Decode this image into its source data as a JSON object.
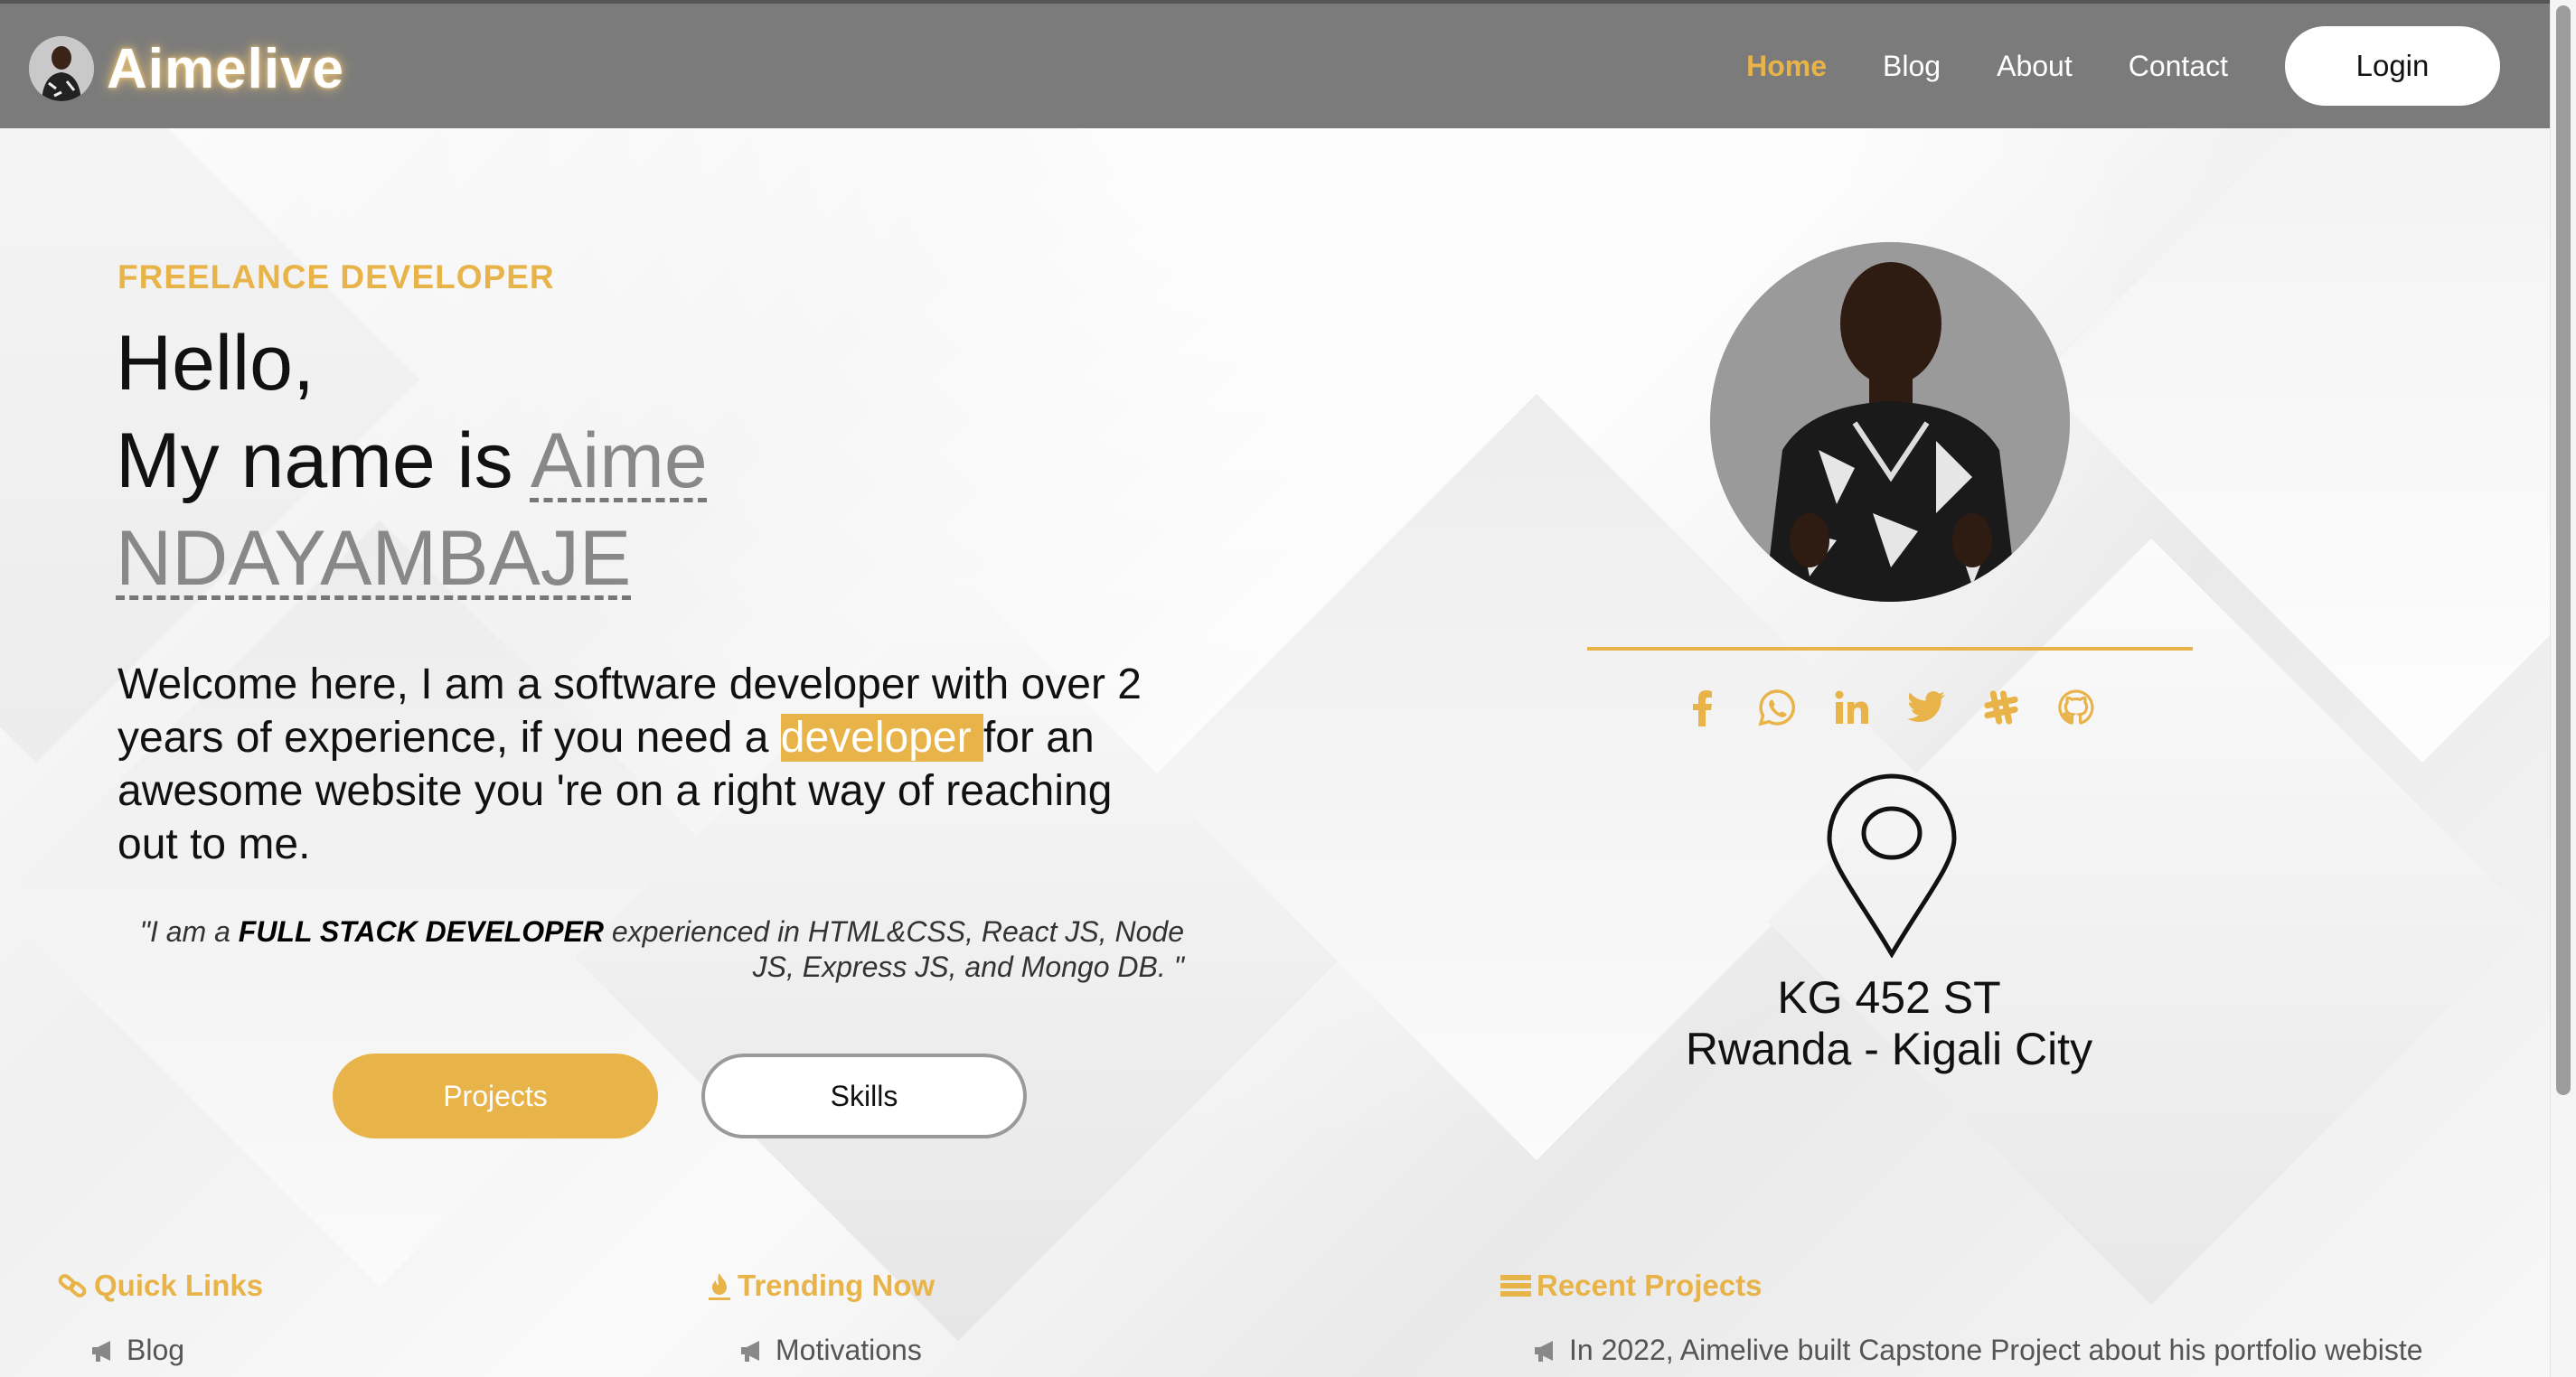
{
  "brand": {
    "name": "Aimelive"
  },
  "nav": {
    "items": [
      "Home",
      "Blog",
      "About",
      "Contact"
    ],
    "active": "Home",
    "login": "Login"
  },
  "hero": {
    "eyebrow": "FREELANCE DEVELOPER",
    "greeting_line1": "Hello,",
    "greeting_line2": "My name is ",
    "name_first": "Aime",
    "name_last": "NDAYAMBAJE",
    "intro_before": "Welcome here, I am a software developer with over 2 years of experience, if you need a ",
    "intro_highlight": "developer ",
    "intro_after": "for an awesome website you 're on a right way of reaching out to me.",
    "quote_before": "\"I am a ",
    "quote_bold": "FULL STACK DEVELOPER",
    "quote_after": " experienced in HTML&CSS, React JS, Node JS, Express JS, and Mongo DB. \"",
    "projects_button": "Projects",
    "skills_button": "Skills"
  },
  "profile": {
    "socials": [
      "facebook-icon",
      "whatsapp-icon",
      "linkedin-icon",
      "twitter-icon",
      "slack-icon",
      "github-icon"
    ],
    "address_line1": "KG 452 ST",
    "address_line2": "Rwanda - Kigali City"
  },
  "footer": {
    "quick_links": {
      "title": "Quick Links",
      "items": [
        "Blog"
      ]
    },
    "trending": {
      "title": "Trending Now",
      "items": [
        "Motivations"
      ]
    },
    "recent_projects": {
      "title": "Recent Projects",
      "items": [
        "In 2022, Aimelive built Capstone Project about his portfolio webiste"
      ]
    }
  },
  "colors": {
    "accent": "#e8b44a",
    "navbar": "#7b7b7b"
  }
}
